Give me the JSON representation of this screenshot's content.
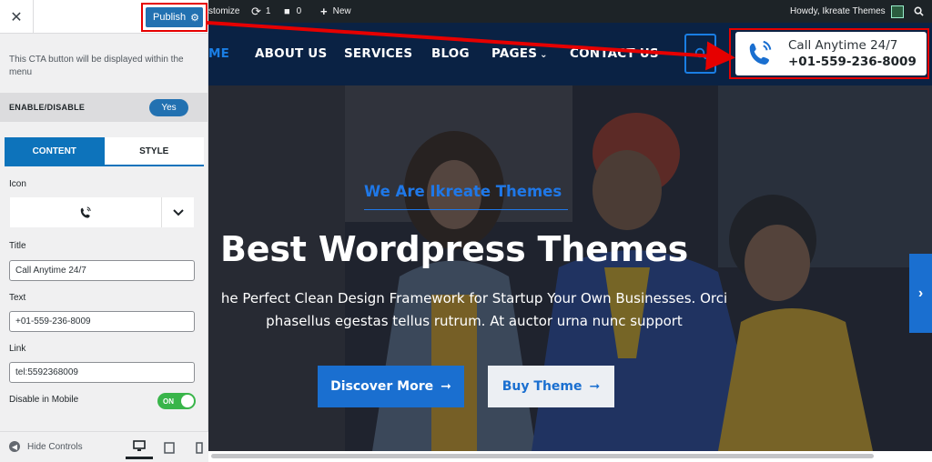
{
  "panel": {
    "close_icon": "close-icon",
    "publish_label": "Publish",
    "description": "This CTA button will be displayed within the menu",
    "enable_label": "ENABLE/DISABLE",
    "enable_value": "Yes",
    "tabs": [
      "CONTENT",
      "STYLE"
    ],
    "icon_label": "Icon",
    "selected_icon": "phone-volume-icon",
    "title_label": "Title",
    "title_value": "Call Anytime 24/7",
    "text_label": "Text",
    "text_value": "+01-559-236-8009",
    "link_label": "Link",
    "link_value": "tel:5592368009",
    "mobile_label": "Disable in Mobile",
    "mobile_toggle": "ON",
    "hide_controls": "Hide Controls"
  },
  "adminbar": {
    "customize": "stomize",
    "updates_count": "1",
    "comments_count": "0",
    "new_label": "New",
    "howdy": "Howdy, Ikreate Themes"
  },
  "nav": {
    "items": [
      "ME",
      "ABOUT US",
      "SERVICES",
      "BLOG",
      "PAGES",
      "CONTACT US"
    ]
  },
  "cta": {
    "title": "Call Anytime 24/7",
    "text": "+01-559-236-8009"
  },
  "hero": {
    "tagline": "We Are Ikreate Themes",
    "title": "Best Wordpress Themes",
    "subtitle_line1": "he Perfect Clean Design Framework for Startup Your Own Businesses. Orci",
    "subtitle_line2": "phasellus egestas tellus rutrum. At auctor urna nunc support",
    "discover": "Discover More",
    "buy": "Buy Theme"
  },
  "colors": {
    "accent": "#1a6fd0",
    "header_bg": "#0a2244",
    "highlight": "#e60000",
    "toggle_on": "#39b54a"
  }
}
